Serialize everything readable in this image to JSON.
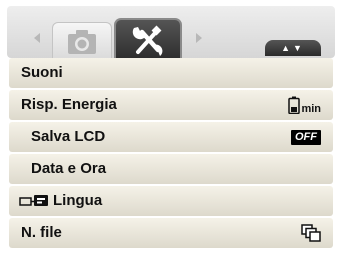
{
  "tabs": [
    {
      "name": "camera",
      "icon": "camera-icon"
    },
    {
      "name": "setup",
      "icon": "wrench-screwdriver-icon",
      "selected": true
    }
  ],
  "page_indicator": "▲▼",
  "menu": [
    {
      "label": "Suoni",
      "value": ""
    },
    {
      "label": "Risp. Energia",
      "value": "min",
      "value_icon": "battery-icon"
    },
    {
      "label": "Salva LCD",
      "value": "OFF"
    },
    {
      "label": "Data e Ora",
      "value": ""
    },
    {
      "label": "Lingua",
      "icon": "language-icon",
      "value": ""
    },
    {
      "label": "N. file",
      "value": "",
      "value_icon": "file-series-icon"
    }
  ],
  "colors": {
    "row_top": "#f5f2e8",
    "row_bottom": "#ddd9cc",
    "selected_tab": "#333333",
    "text": "#111111"
  }
}
